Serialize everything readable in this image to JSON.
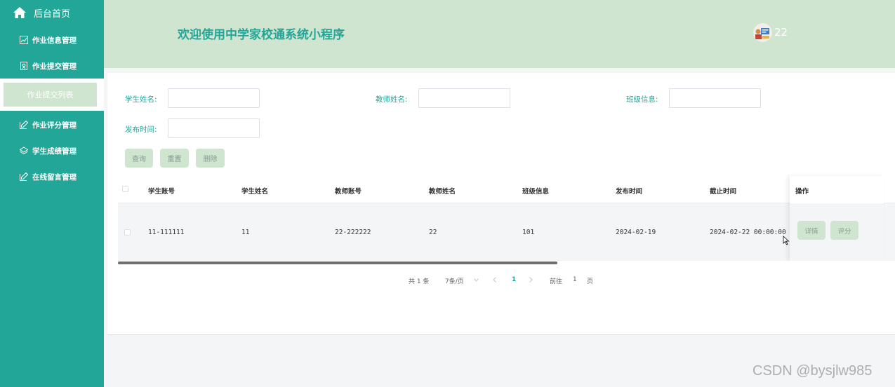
{
  "sidebar": {
    "home_label": "后台首页",
    "items": [
      {
        "label": "作业信息管理",
        "icon": "chart-icon"
      },
      {
        "label": "作业提交管理",
        "icon": "clipboard-icon"
      },
      {
        "label": "作业评分管理",
        "icon": "edit-icon"
      },
      {
        "label": "学生成绩管理",
        "icon": "layers-icon"
      },
      {
        "label": "在线留言管理",
        "icon": "edit-icon"
      }
    ],
    "active_sub_item": "作业提交列表"
  },
  "header": {
    "title": "欢迎使用中学家校通系统小程序",
    "username": "22"
  },
  "search": {
    "student_name_label": "学生姓名:",
    "student_name_value": "",
    "teacher_name_label": "教师姓名:",
    "teacher_name_value": "",
    "class_label": "班级信息:",
    "class_value": "",
    "publish_time_label": "发布时间:",
    "publish_time_value": ""
  },
  "actions": {
    "query": "查询",
    "reset": "重置",
    "delete": "删除"
  },
  "table": {
    "columns": [
      "学生账号",
      "学生姓名",
      "教师账号",
      "教师姓名",
      "班级信息",
      "发布时间",
      "截止时间",
      "操作"
    ],
    "rows": [
      {
        "cells": [
          "11-111111",
          "11",
          "22-222222",
          "22",
          "101",
          "2024-02-19",
          "2024-02-22 00:00:00"
        ],
        "detail_label": "详情",
        "grade_label": "评分"
      }
    ]
  },
  "pagination": {
    "total_text": "共 1 条",
    "page_size": "7条/页",
    "current_page": "1",
    "goto_prefix": "前往",
    "goto_value": "1",
    "goto_suffix": "页"
  },
  "watermark": "CSDN @bysjlw985",
  "colors": {
    "sidebar_bg": "#22a698",
    "header_bg": "#cfe5d0",
    "accent": "#22a698"
  }
}
